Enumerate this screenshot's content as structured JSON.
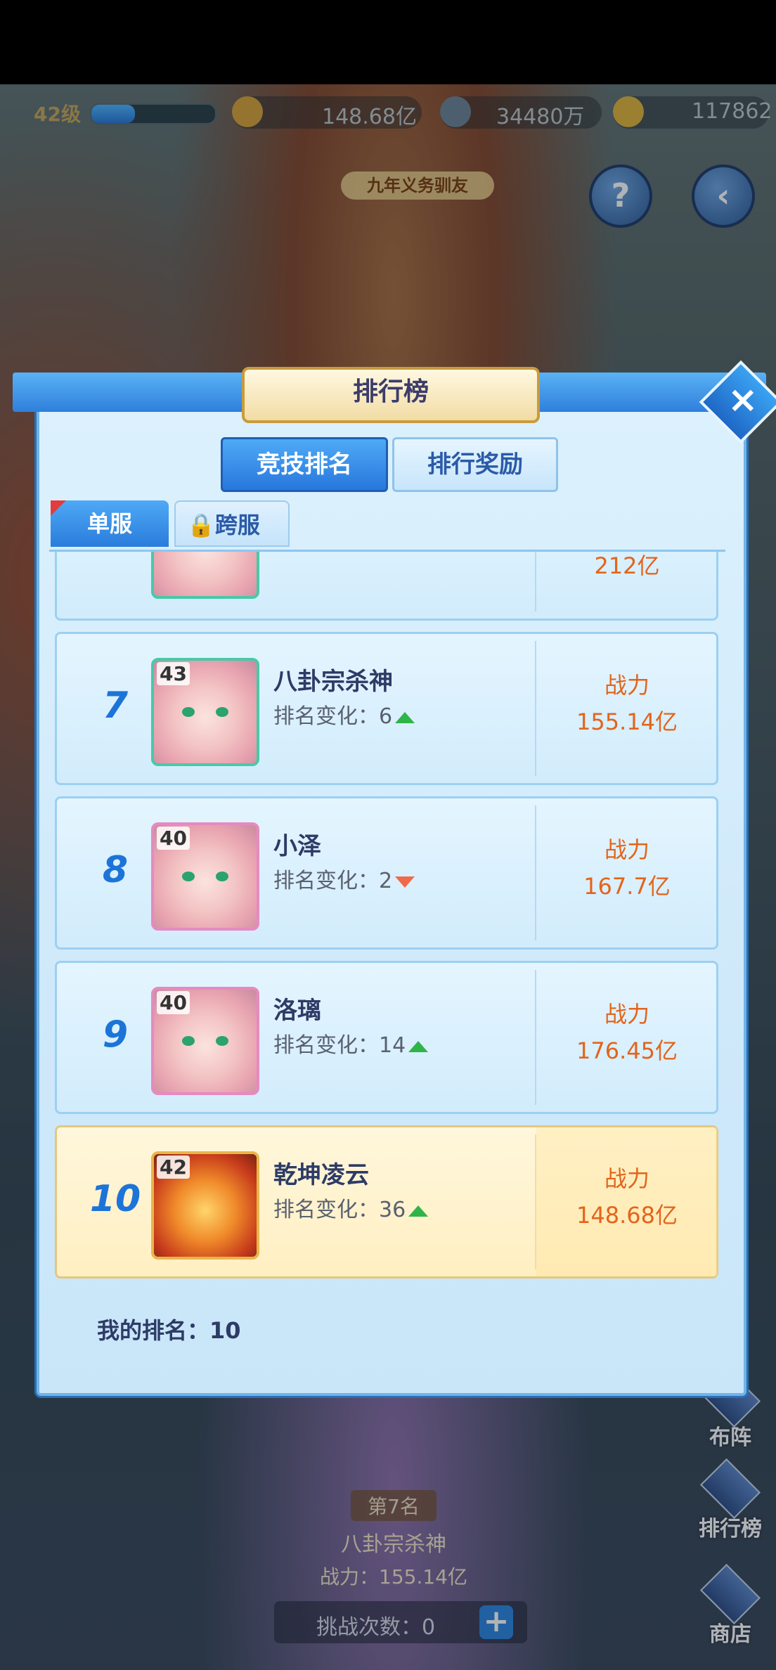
{
  "topbar": {
    "level": "42级",
    "exp_progress": 0.35,
    "power_value": "148.68亿",
    "silver_value": "34480万",
    "gold_value": "117862"
  },
  "event": {
    "banner": "九年义务驯友"
  },
  "side_buttons": {
    "formation": "布阵",
    "leaderboard": "排行榜",
    "shop": "商店"
  },
  "bottom": {
    "rank": "第7名",
    "name": "八卦宗杀神",
    "power": "战力：155.14亿",
    "challenges": "挑战次数：0"
  },
  "modal": {
    "title": "排行榜",
    "tabs": {
      "arena": "竞技排名",
      "reward": "排行奖励"
    },
    "subtabs": {
      "single": "单服",
      "cross": "跨服"
    },
    "partial_power": "212亿",
    "power_label": "战力",
    "change_label": "排名变化：",
    "rows": [
      {
        "rank": "7",
        "level": "43",
        "name": "八卦宗杀神",
        "change": "6",
        "dir": "up",
        "power": "155.14亿"
      },
      {
        "rank": "8",
        "level": "40",
        "name": "小泽",
        "change": "2",
        "dir": "down",
        "power": "167.7亿"
      },
      {
        "rank": "9",
        "level": "40",
        "name": "洛璃",
        "change": "14",
        "dir": "up",
        "power": "176.45亿"
      },
      {
        "rank": "10",
        "level": "42",
        "name": "乾坤凌云",
        "change": "36",
        "dir": "up",
        "power": "148.68亿"
      }
    ],
    "my_rank": "我的排名：10"
  },
  "colors": {
    "accent": "#2877dc",
    "power": "#e3641c",
    "up": "#2fb44a",
    "down": "#f06a4a"
  }
}
